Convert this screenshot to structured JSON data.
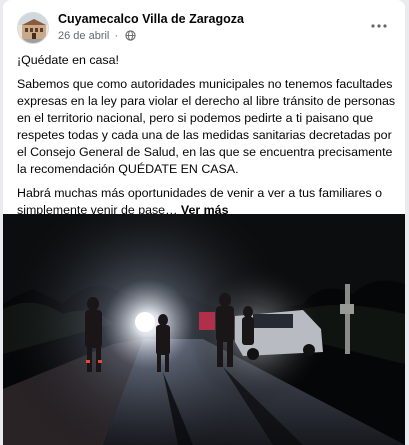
{
  "post": {
    "page_name": "Cuyamecalco Villa de Zaragoza",
    "date": "26 de abril",
    "separator": "·",
    "privacy_icon": "globe-icon",
    "more_icon": "more-options-icon",
    "greeting": "¡Quédate en casa!",
    "paragraph": "Sabemos que como autoridades municipales no tenemos facultades expresas en la ley para violar el derecho al libre tránsito de personas en el territorio nacional, pero si podemos pedirte a ti paisano que respetes todas y cada una de las medidas sanitarias decretadas por el Consejo General de Salud, en las que se encuentra precisamente la recomendación QUÉDATE EN CASA.",
    "teaser": "Habrá muchas más oportunidades de venir a ver a tus familiares o simplemente venir de pase…",
    "see_more": "Ver más"
  },
  "colors": {
    "page_background": "#e9ebee",
    "card": "#ffffff",
    "secondary_text": "#65676b",
    "primary_text": "#050505"
  }
}
